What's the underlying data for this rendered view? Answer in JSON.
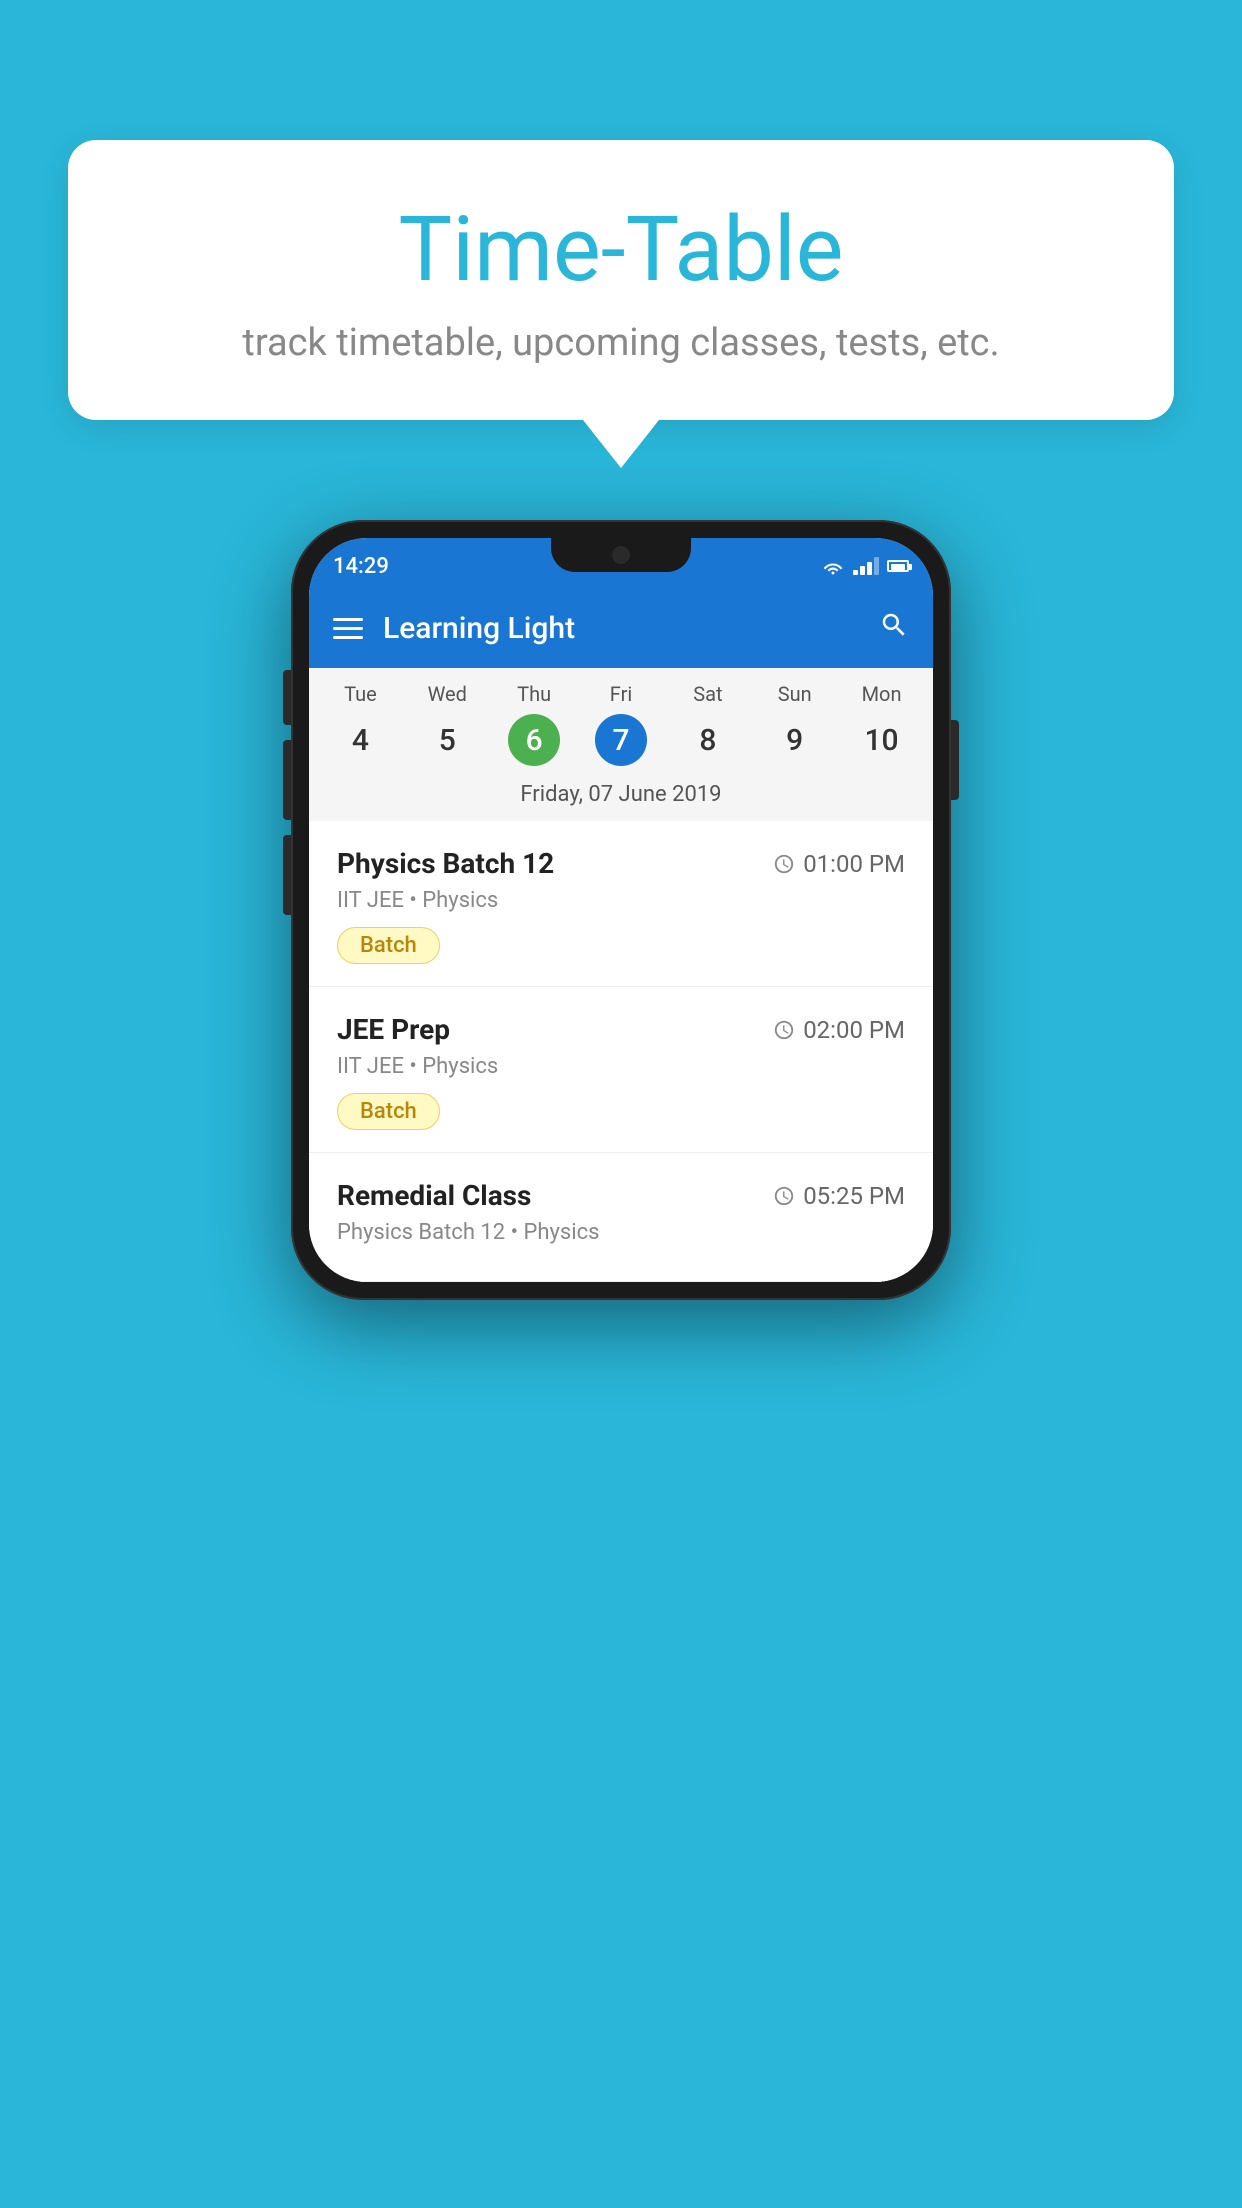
{
  "background_color": "#29B6D8",
  "speech_bubble": {
    "title": "Time-Table",
    "subtitle": "track timetable, upcoming classes, tests, etc."
  },
  "phone": {
    "status_bar": {
      "time": "14:29"
    },
    "app_bar": {
      "title": "Learning Light"
    },
    "calendar": {
      "days_of_week": [
        "Tue",
        "Wed",
        "Thu",
        "Fri",
        "Sat",
        "Sun",
        "Mon"
      ],
      "dates": [
        "4",
        "5",
        "6",
        "7",
        "8",
        "9",
        "10"
      ],
      "today_index": 2,
      "selected_index": 3,
      "selected_date_label": "Friday, 07 June 2019"
    },
    "schedule": [
      {
        "title": "Physics Batch 12",
        "time": "01:00 PM",
        "subtitle": "IIT JEE • Physics",
        "badge": "Batch"
      },
      {
        "title": "JEE Prep",
        "time": "02:00 PM",
        "subtitle": "IIT JEE • Physics",
        "badge": "Batch"
      },
      {
        "title": "Remedial Class",
        "time": "05:25 PM",
        "subtitle": "Physics Batch 12 • Physics",
        "badge": null
      }
    ]
  }
}
